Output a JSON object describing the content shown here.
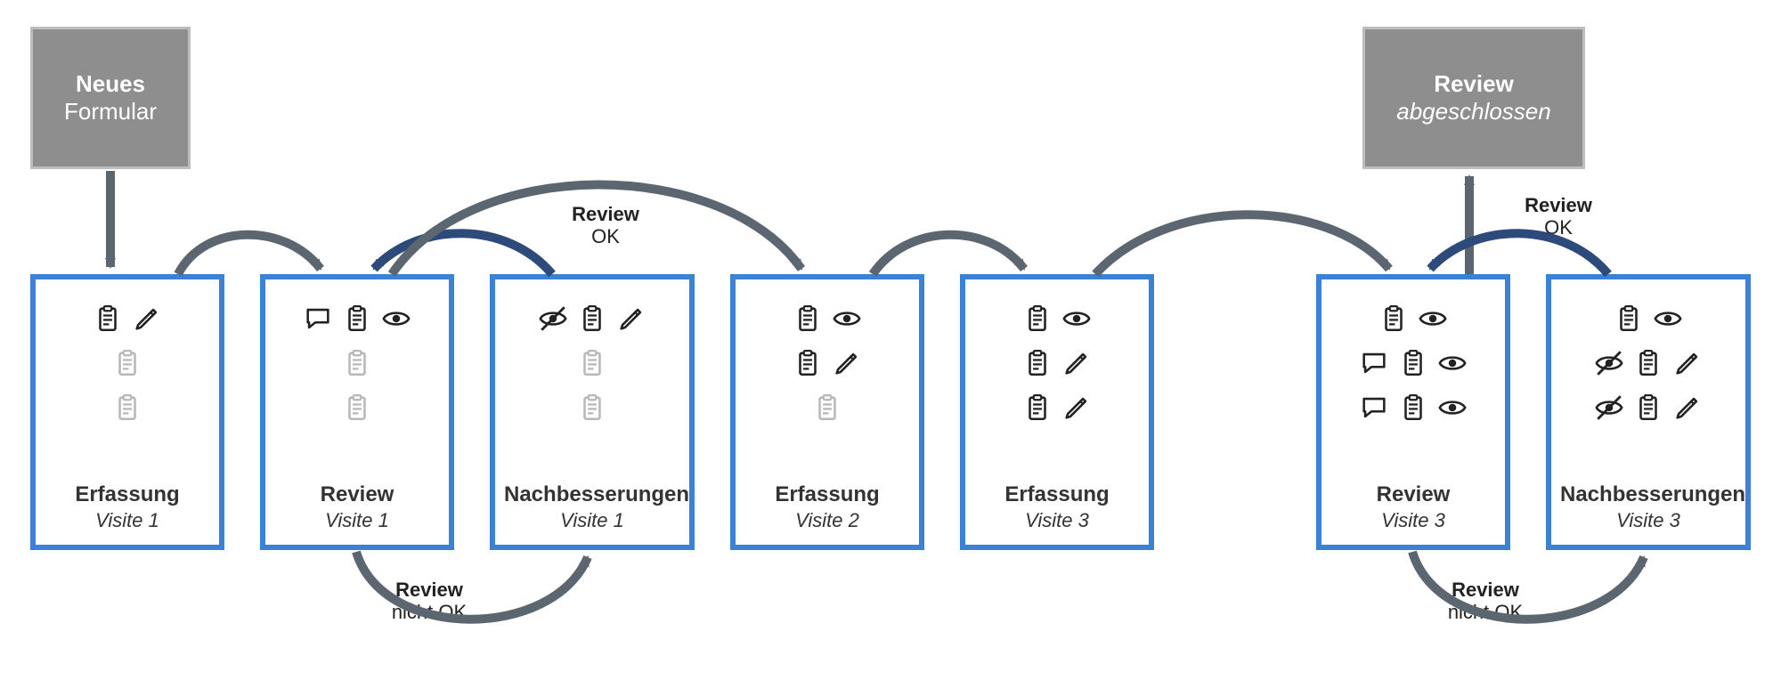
{
  "grayBoxes": {
    "start": {
      "line1": "Neues",
      "line2": "Formular"
    },
    "end": {
      "line1": "Review",
      "line2": "abgeschlossen"
    }
  },
  "boxes": [
    {
      "id": "b1",
      "title": "Erfassung",
      "sub": "Visite 1",
      "rows": [
        [
          "clipboard",
          "pencil"
        ],
        [
          "clipboard-gray"
        ],
        [
          "clipboard-gray"
        ]
      ]
    },
    {
      "id": "b2",
      "title": "Review",
      "sub": "Visite 1",
      "rows": [
        [
          "comment",
          "clipboard",
          "eye"
        ],
        [
          "clipboard-gray"
        ],
        [
          "clipboard-gray"
        ]
      ]
    },
    {
      "id": "b3",
      "title": "Nachbesserungen",
      "sub": "Visite 1",
      "rows": [
        [
          "eye-slash",
          "clipboard",
          "pencil"
        ],
        [
          "clipboard-gray"
        ],
        [
          "clipboard-gray"
        ]
      ]
    },
    {
      "id": "b4",
      "title": "Erfassung",
      "sub": "Visite 2",
      "rows": [
        [
          "clipboard",
          "eye"
        ],
        [
          "clipboard",
          "pencil"
        ],
        [
          "clipboard-gray"
        ]
      ]
    },
    {
      "id": "b5",
      "title": "Erfassung",
      "sub": "Visite 3",
      "rows": [
        [
          "clipboard",
          "eye"
        ],
        [
          "clipboard",
          "pencil"
        ],
        [
          "clipboard",
          "pencil"
        ]
      ]
    },
    {
      "id": "b6",
      "title": "Review",
      "sub": "Visite 3",
      "rows": [
        [
          "clipboard",
          "eye"
        ],
        [
          "comment",
          "clipboard",
          "eye"
        ],
        [
          "comment",
          "clipboard",
          "eye"
        ]
      ]
    },
    {
      "id": "b7",
      "title": "Nachbesserungen",
      "sub": "Visite 3",
      "rows": [
        [
          "clipboard",
          "eye"
        ],
        [
          "eye-slash",
          "clipboard",
          "pencil"
        ],
        [
          "eye-slash",
          "clipboard",
          "pencil"
        ]
      ]
    }
  ],
  "arrowLabels": {
    "reviewOkTop": {
      "bold": "Review",
      "normal": "OK"
    },
    "reviewOkRight": {
      "bold": "Review",
      "normal": "OK"
    },
    "reviewNokLeft": {
      "bold": "Review",
      "normal": "nicht OK"
    },
    "reviewNokRight": {
      "bold": "Review",
      "normal": "nicht OK"
    }
  },
  "colors": {
    "gray": "#5c6670",
    "navy": "#2c4a7a",
    "boxBorder": "#3b82d6"
  }
}
